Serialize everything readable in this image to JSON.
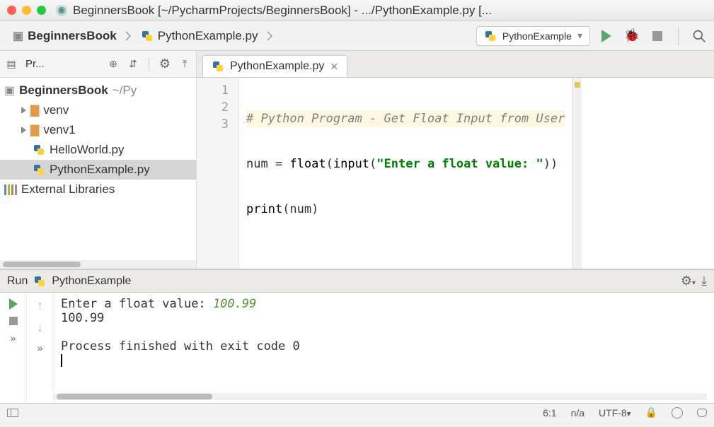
{
  "window": {
    "title": "BeginnersBook [~/PycharmProjects/BeginnersBook] - .../PythonExample.py [..."
  },
  "breadcrumb": {
    "project": "BeginnersBook",
    "file": "PythonExample.py"
  },
  "runconfig": {
    "name": "PythonExample"
  },
  "sidebar": {
    "toolbar_label": "Pr...",
    "root_name": "BeginnersBook",
    "root_path": "~/Py",
    "items": [
      {
        "name": "venv",
        "icon": "folder-orange"
      },
      {
        "name": "venv1",
        "icon": "folder-orange"
      },
      {
        "name": "HelloWorld.py",
        "icon": "python"
      },
      {
        "name": "PythonExample.py",
        "icon": "python",
        "selected": true
      }
    ],
    "external": "External Libraries"
  },
  "editor": {
    "tab": "PythonExample.py",
    "lines": [
      "1",
      "2",
      "3"
    ],
    "code": {
      "l1_comment": "# Python Program - Get Float Input from User",
      "l2_pre": "num = ",
      "l2_float": "float",
      "l2_mid": "(",
      "l2_input": "input",
      "l2_open": "(",
      "l2_str": "\"Enter a float value: \"",
      "l2_end": "))",
      "l3_print": "print",
      "l3_arg": "(num)"
    }
  },
  "run": {
    "label": "Run",
    "name": "PythonExample",
    "out_prompt": "Enter a float value: ",
    "out_input": "100.99",
    "out_echo": "100.99",
    "out_exit": "Process finished with exit code 0"
  },
  "status": {
    "pos": "6:1",
    "na": "n/a",
    "enc": "UTF-8"
  }
}
